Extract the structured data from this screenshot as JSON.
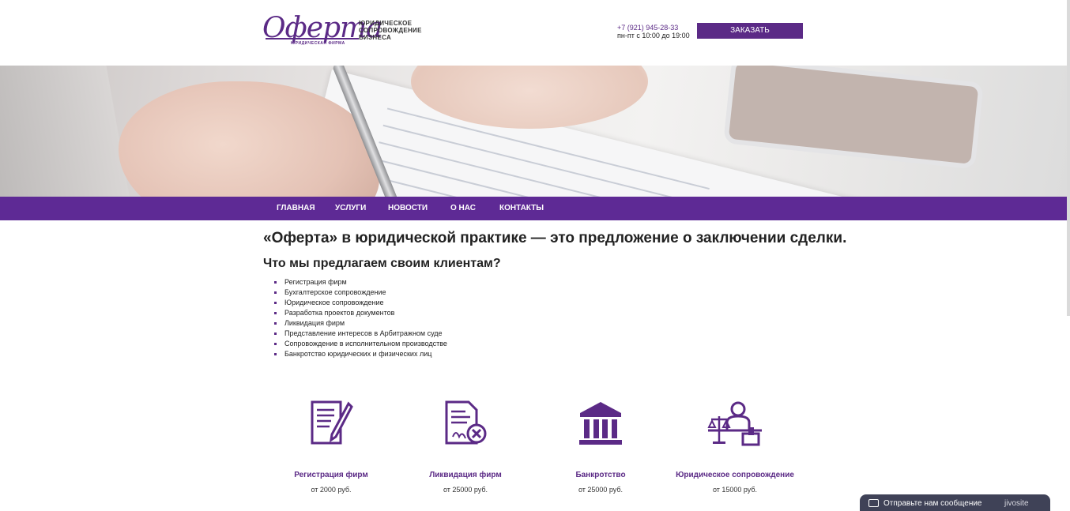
{
  "header": {
    "logo_script": "Оферта",
    "logo_sub": "ЮРИДИЧЕСКАЯ ФИРМА",
    "logo_tag_line1": "ЮРИДИЧЕСКОЕ",
    "logo_tag_line2": "СОПРОВОЖДЕНИЕ",
    "logo_tag_line3": "БИЗНЕСА",
    "phone": "+7 (921) 945-28-33",
    "hours": "пн-пт с 10:00 до 19:00",
    "cta_label": "ЗАКАЗАТЬ КОНСУЛЬТАЦИЮ"
  },
  "nav": {
    "items": [
      {
        "label": "ГЛАВНАЯ"
      },
      {
        "label": "УСЛУГИ"
      },
      {
        "label": "НОВОСТИ"
      },
      {
        "label": "О НАС"
      },
      {
        "label": "КОНТАКТЫ"
      }
    ]
  },
  "main": {
    "lead": "«Оферта» в юридической практике — это предложение о заключении сделки.",
    "subhead": "Что мы предлагаем своим клиентам?",
    "services": [
      "Регистрация фирм",
      "Бухгалтерское сопровождение",
      "Юридическое сопровождение",
      "Разработка проектов документов",
      "Ликвидация фирм",
      "Представление интересов в Арбитражном суде",
      "Сопровождение в исполнительном производстве",
      "Банкротство юридических и физических лиц"
    ],
    "cards": [
      {
        "title": "Регистрация фирм",
        "price": "от 2000 руб.",
        "icon": "document-pen-icon"
      },
      {
        "title": "Ликвидация фирм",
        "price": "от 25000 руб.",
        "icon": "document-cancel-icon"
      },
      {
        "title": "Банкротство",
        "price": "от 25000 руб.",
        "icon": "courthouse-icon"
      },
      {
        "title": "Юридическое сопровождение",
        "price": "от 15000 руб.",
        "icon": "lawyer-desk-icon"
      }
    ]
  },
  "chat": {
    "label": "Отправьте нам сообщение",
    "brand": "jivosite"
  },
  "colors": {
    "brand": "#5b2a86",
    "nav": "#5e2a95",
    "chat": "#3f4257"
  }
}
